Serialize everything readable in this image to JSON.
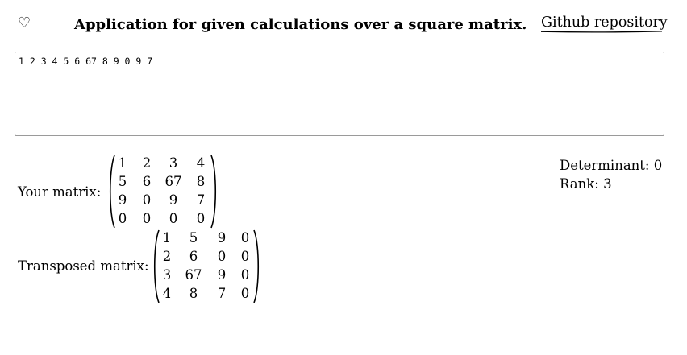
{
  "header": {
    "favorite_icon": "heart-outline-icon",
    "favorite_glyph": "♡",
    "title": "Application for given calculations over a square matrix.",
    "repo_link": "Github repository"
  },
  "input": {
    "value": "1 2 3 4 5 6 67 8 9 0 9 7"
  },
  "results": {
    "determinant_label": "Determinant: 0",
    "rank_label": "Rank: 3"
  },
  "matrix": {
    "label": "Your matrix:",
    "rows": [
      [
        "1",
        "2",
        "3",
        "4"
      ],
      [
        "5",
        "6",
        "67",
        "8"
      ],
      [
        "9",
        "0",
        "9",
        "7"
      ],
      [
        "0",
        "0",
        "0",
        "0"
      ]
    ]
  },
  "transposed": {
    "label": "Transposed matrix:",
    "rows": [
      [
        "1",
        "5",
        "9",
        "0"
      ],
      [
        "2",
        "6",
        "0",
        "0"
      ],
      [
        "3",
        "67",
        "9",
        "0"
      ],
      [
        "4",
        "8",
        "7",
        "0"
      ]
    ]
  }
}
